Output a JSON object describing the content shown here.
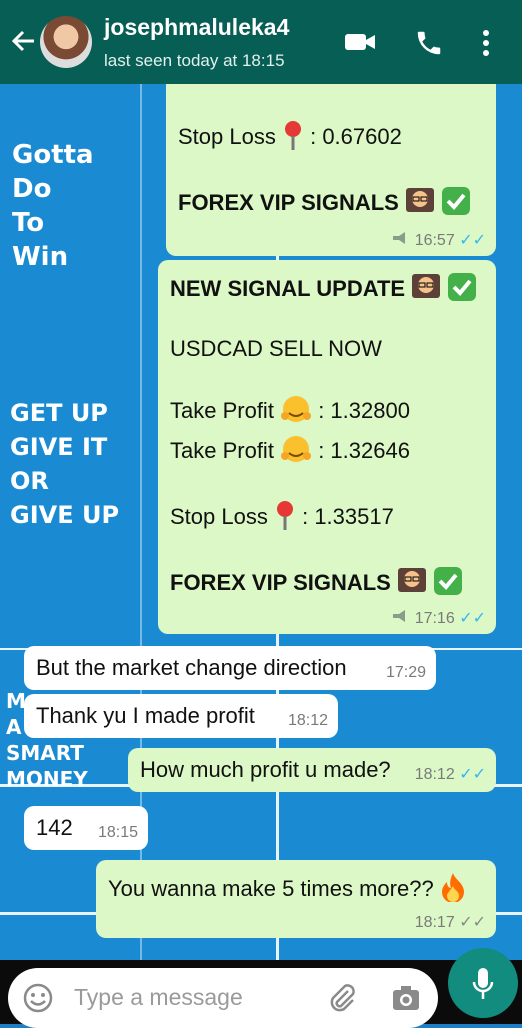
{
  "header": {
    "contact_name": "josephmaluleka4",
    "last_seen": "last seen today at 18:15"
  },
  "wallpaper": {
    "motto1": [
      "Gotta",
      "Do",
      "To",
      "Win"
    ],
    "motto2": [
      "GET UP",
      "GIVE IT",
      "OR",
      "GIVE UP"
    ],
    "motto3": [
      "M",
      "A",
      "SMART",
      "MONEY"
    ]
  },
  "messages": {
    "m1": {
      "stop_loss": "Stop Loss",
      "stop_value": ": 0.67602",
      "footer": "FOREX VIP SIGNALS",
      "time": "16:57"
    },
    "m2": {
      "title": "NEW SIGNAL UPDATE",
      "pair": "USDCAD SELL NOW",
      "tp1_label": "Take Profit",
      "tp1_value": ": 1.32800",
      "tp2_label": "Take Profit",
      "tp2_value": ": 1.32646",
      "sl_label": "Stop Loss",
      "sl_value": ": 1.33517",
      "footer": "FOREX VIP SIGNALS",
      "time": "17:16"
    },
    "m3": {
      "text": "But the market change direction",
      "time": "17:29"
    },
    "m4": {
      "text": "Thank yu I made profit",
      "time": "18:12"
    },
    "m5": {
      "text": "How much profit u made?",
      "time": "18:12"
    },
    "m6": {
      "text": "142",
      "time": "18:15"
    },
    "m7": {
      "text": "You wanna make 5 times more??",
      "time": "18:17"
    }
  },
  "composer": {
    "placeholder": "Type a message"
  },
  "icons": [
    "back-arrow-icon",
    "video-call-icon",
    "phone-icon",
    "more-vert-icon",
    "emoji-icon",
    "attach-icon",
    "camera-icon",
    "mic-icon"
  ],
  "colors": {
    "header": "#075e54",
    "outgoing": "#dcf8c6",
    "incoming": "#ffffff",
    "read_ticks": "#34b7f1",
    "mic": "#128c7e"
  }
}
